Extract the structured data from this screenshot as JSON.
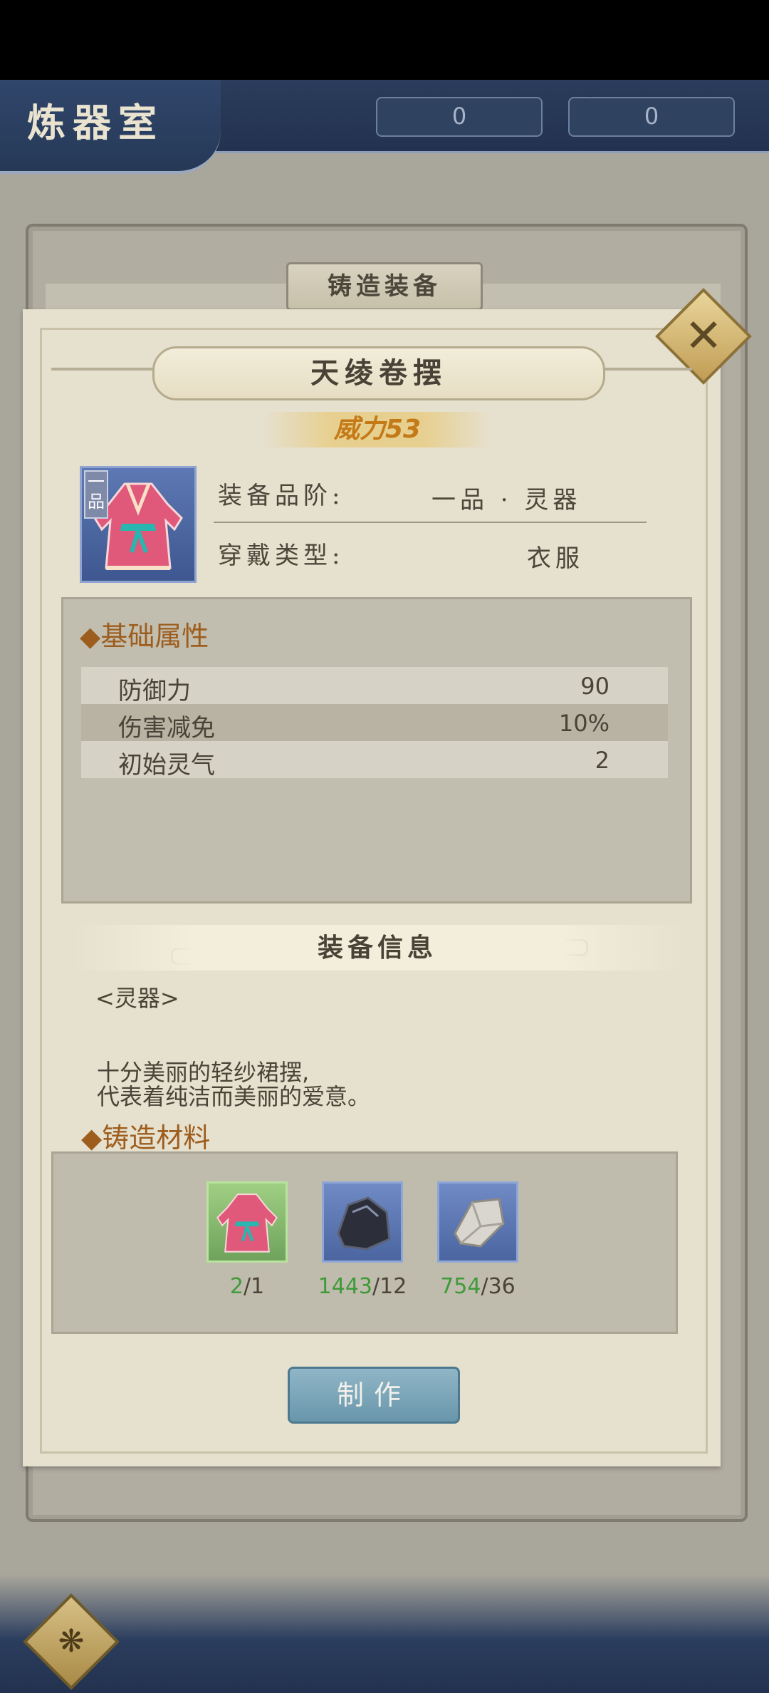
{
  "header": {
    "title": "炼器室",
    "currencies": [
      {
        "icon": "feather-icon",
        "value": "0"
      },
      {
        "icon": "quill-icon",
        "value": "0"
      }
    ]
  },
  "panel": {
    "tab_label": "铸造装备"
  },
  "item": {
    "name": "天绫卷摆",
    "power_label": "威力53",
    "grade_tag": "一品",
    "quality_label": "装备品阶:",
    "quality_value": "一品 · 灵器",
    "wear_label": "穿戴类型:",
    "wear_value": "衣服"
  },
  "attributes": {
    "title": "◆基础属性",
    "rows": [
      {
        "name": "防御力",
        "value": "90"
      },
      {
        "name": "伤害减免",
        "value": "10%"
      },
      {
        "name": "初始灵气",
        "value": "2"
      }
    ]
  },
  "info": {
    "title": "装备信息",
    "tag": "<灵器>",
    "description": [
      "十分美丽的轻纱裙摆,",
      "代表着纯洁而美丽的爱意。"
    ]
  },
  "materials": {
    "title": "◆铸造材料",
    "items": [
      {
        "icon": "robe-icon",
        "have": "2",
        "need": "/1",
        "color": "#6fa35c"
      },
      {
        "icon": "ore-icon",
        "have": "1443",
        "need": "/12",
        "color": "#5d78b4"
      },
      {
        "icon": "crystal-icon",
        "have": "754",
        "need": "/36",
        "color": "#5d78b4"
      }
    ]
  },
  "actions": {
    "make_label": "制作"
  }
}
